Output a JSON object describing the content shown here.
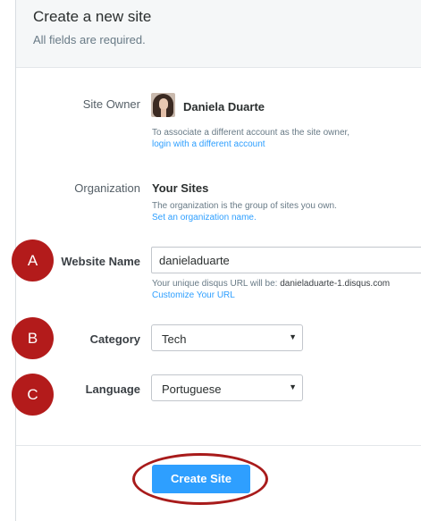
{
  "header": {
    "title": "Create a new site",
    "subtitle": "All fields are required."
  },
  "site_owner": {
    "label": "Site Owner",
    "name": "Daniela Duarte",
    "help_text": "To associate a different account as the site owner,",
    "help_link": "login with a different account"
  },
  "organization": {
    "label": "Organization",
    "value": "Your Sites",
    "help_text": "The organization is the group of sites you own.",
    "help_link": "Set an organization name."
  },
  "website_name": {
    "label": "Website Name",
    "value": "danieladuarte",
    "help_prefix": "Your unique disqus URL will be: ",
    "help_url": "danieladuarte-1.disqus.com",
    "help_link": "Customize Your URL"
  },
  "category": {
    "label": "Category",
    "selected": "Tech"
  },
  "language": {
    "label": "Language",
    "selected": "Portuguese"
  },
  "annotations": {
    "a": "A",
    "b": "B",
    "c": "C"
  },
  "create_button": {
    "label": "Create Site"
  },
  "colors": {
    "accent": "#2e9fff",
    "annotation": "#b31b1b"
  }
}
